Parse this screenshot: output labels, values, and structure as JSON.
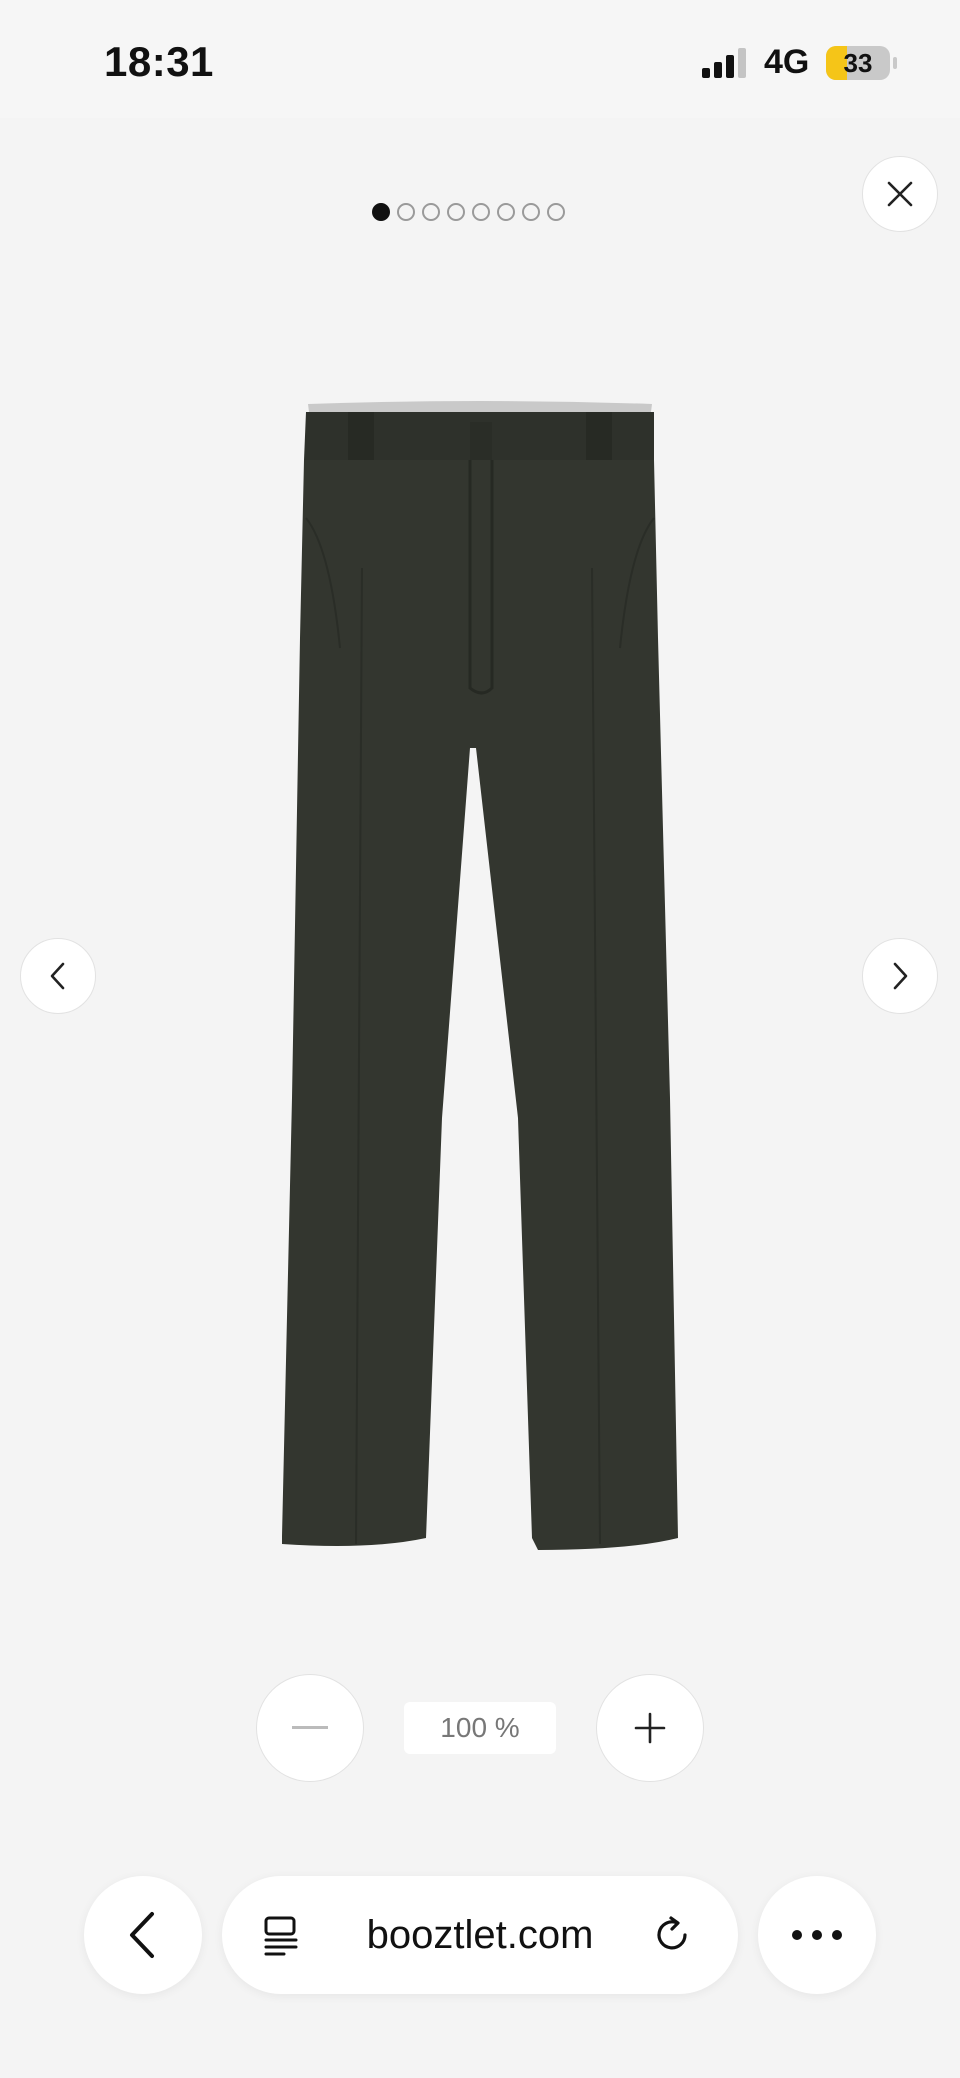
{
  "status": {
    "time": "18:31",
    "network": "4G",
    "battery_level": 33,
    "battery_text": "33"
  },
  "gallery": {
    "total_images": 8,
    "active_index": 0,
    "product_image_alt": "Dark olive work trousers"
  },
  "zoom": {
    "level": "100 %"
  },
  "browser": {
    "url": "booztlet.com"
  },
  "icons": {
    "close": "close-icon",
    "prev": "chevron-left-icon",
    "next": "chevron-right-icon",
    "zoom_out": "minus-icon",
    "zoom_in": "plus-icon",
    "back": "back-arrow-icon",
    "tabs": "tabs-icon",
    "reload": "reload-icon",
    "more": "more-icon"
  },
  "colors": {
    "background": "#f4f4f4",
    "battery_fill": "#f5c518",
    "product": "#33362f"
  }
}
